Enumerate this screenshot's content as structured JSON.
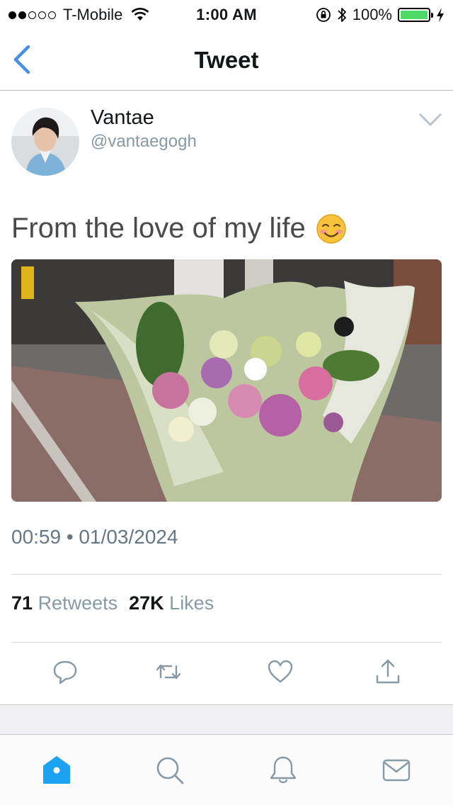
{
  "status_bar": {
    "signal_filled": 2,
    "signal_total": 5,
    "carrier": "T-Mobile",
    "time": "1:00 AM",
    "battery": "100%",
    "battery_level": 1.0,
    "icons": [
      "wifi-icon",
      "orientation-lock-icon",
      "bluetooth-icon",
      "battery-icon",
      "charging-icon"
    ]
  },
  "nav": {
    "title": "Tweet",
    "back_icon": "chevron-left-icon"
  },
  "tweet": {
    "author_name": "Vantae",
    "author_handle": "@vantaegogh",
    "text": "From the love of my life",
    "emoji": "☺️",
    "timestamp": "00:59 • 01/03/2024",
    "retweets_count": "71",
    "retweets_label": "Retweets",
    "likes_count": "27K",
    "likes_label": "Likes",
    "media_alt": "bouquet of pink and purple flowers wrapped in pale green paper"
  },
  "actions": [
    "reply-icon",
    "retweet-icon",
    "like-icon",
    "share-icon"
  ],
  "tabbar": [
    "home-icon",
    "search-icon",
    "notifications-icon",
    "messages-icon"
  ],
  "colors": {
    "twitter_blue": "#1da1f2",
    "nav_blue": "#4a90e2",
    "muted_gray": "#8899a6",
    "battery_green": "#4cd964"
  }
}
